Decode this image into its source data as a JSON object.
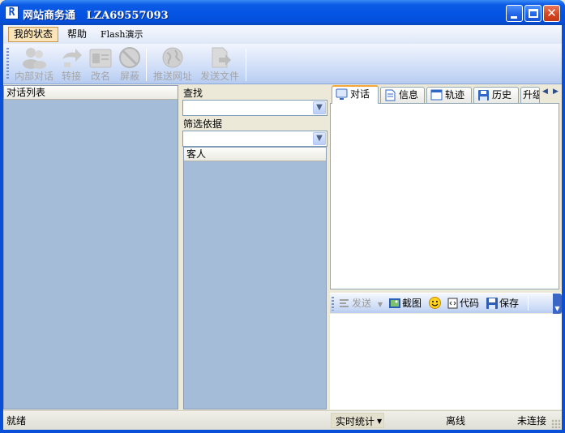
{
  "window": {
    "title": "网站商务通   LZA69557093",
    "colors": {
      "titlebar": "#0554e3",
      "panel_fill": "#a4bcd8",
      "face": "#ece9d8",
      "active_tab_accent": "#f2a83a"
    }
  },
  "menu": [
    {
      "label": "我的状态",
      "active": true
    },
    {
      "label": "帮助",
      "active": false
    },
    {
      "label": "Flash演示",
      "active": false
    }
  ],
  "toolbar": {
    "items": [
      {
        "label": "内部对话",
        "icon": "people-icon",
        "enabled": false
      },
      {
        "label": "转接",
        "icon": "transfer-icon",
        "enabled": false
      },
      {
        "label": "改名",
        "icon": "rename-icon",
        "enabled": false
      },
      {
        "label": "屏蔽",
        "icon": "block-icon",
        "enabled": false
      },
      {
        "label": "推送网址",
        "icon": "globe-icon",
        "enabled": false
      },
      {
        "label": "发送文件",
        "icon": "send-file-icon",
        "enabled": false
      }
    ]
  },
  "left_panel": {
    "header": "对话列表"
  },
  "middle_panel": {
    "search_label": "查找",
    "search_value": "",
    "filter_label": "筛选依据",
    "filter_value": "",
    "guest_header": "客人"
  },
  "right_panel": {
    "tabs": [
      {
        "label": "对话",
        "icon": "monitor-chat-icon",
        "active": true
      },
      {
        "label": "信息",
        "icon": "document-icon",
        "active": false
      },
      {
        "label": "轨迹",
        "icon": "window-trace-icon",
        "active": false
      },
      {
        "label": "历史",
        "icon": "floppy-icon",
        "active": false
      },
      {
        "label": "升级",
        "icon": "upgrade-icon",
        "active": false
      }
    ],
    "chat_toolbar": {
      "send": "发送",
      "screenshot": "截图",
      "code": "代码",
      "save": "保存"
    }
  },
  "status": {
    "ready": "就绪",
    "stats": "实时统计",
    "online_state": "离线",
    "connection": "未连接"
  }
}
